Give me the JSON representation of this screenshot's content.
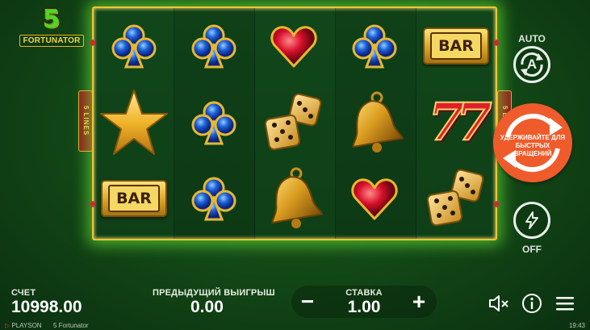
{
  "logo": {
    "number": "5",
    "name": "FORTUNATOR"
  },
  "reels": {
    "lines_label": "5 LINES",
    "symbols": [
      [
        "club-gem",
        "star",
        "bar"
      ],
      [
        "club-gem",
        "club-gem",
        "club-gem"
      ],
      [
        "heart-gem",
        "dice",
        "bell"
      ],
      [
        "club-gem",
        "bell",
        "heart-gem"
      ],
      [
        "bar",
        "seven",
        "dice"
      ]
    ],
    "bar_text": "BAR",
    "seven_text": "77"
  },
  "controls": {
    "auto_label": "AUTO",
    "auto_letter": "A",
    "spin_hint": "УДЕРЖИВАЙТЕ ДЛЯ БЫСТРЫХ ВРАЩЕНИЙ",
    "turbo_state": "OFF"
  },
  "bottom": {
    "balance_label": "СЧЕТ",
    "balance_value": "10998.00",
    "prev_win_label": "ПРЕДЫДУЩИЙ ВЫИГРЫШ",
    "prev_win_value": "0.00",
    "stake_label": "СТАВКА",
    "stake_value": "1.00",
    "minus_label": "−",
    "plus_label": "+"
  },
  "footer": {
    "brand": "PLAYSON",
    "game": "5 Fortunator",
    "time": "19:43"
  },
  "colors": {
    "accent": "#ef5b2a",
    "frame": "#f4c430",
    "glow": "#78ff3c",
    "background": "#134a17"
  }
}
